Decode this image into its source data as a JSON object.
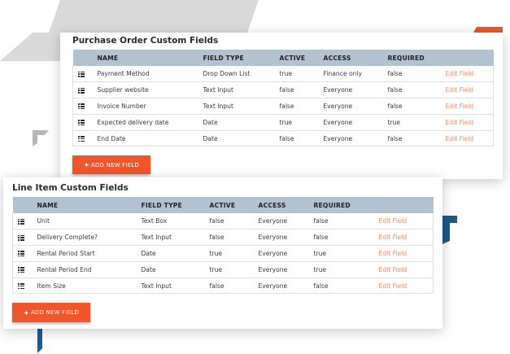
{
  "colors": {
    "accent": "#f0562a",
    "edit_link": "#f08a5e",
    "header_bg": "#b2c2d1",
    "deco_blue": "#1e5a8a",
    "deco_gray": "#d9d9d9"
  },
  "purchase_order": {
    "title": "Purchase Order Custom Fields",
    "columns": [
      "NAME",
      "FIELD TYPE",
      "ACTIVE",
      "ACCESS",
      "REQUIRED",
      ""
    ],
    "rows": [
      {
        "name": "Payment Method",
        "field_type": "Drop Down List",
        "active": "true",
        "access": "Finance only",
        "required": "false",
        "action": "Edit Field"
      },
      {
        "name": "Supplier website",
        "field_type": "Text Input",
        "active": "false",
        "access": "Everyone",
        "required": "false",
        "action": "Edit Field"
      },
      {
        "name": "Invoice Number",
        "field_type": "Text Input",
        "active": "false",
        "access": "Everyone",
        "required": "false",
        "action": "Edit Field"
      },
      {
        "name": "Expected delivery date",
        "field_type": "Date",
        "active": "true",
        "access": "Everyone",
        "required": "true",
        "action": "Edit Field"
      },
      {
        "name": "End Date",
        "field_type": "Date",
        "active": "false",
        "access": "Everyone",
        "required": "false",
        "action": "Edit Field"
      }
    ],
    "add_button": "ADD NEW FIELD"
  },
  "line_item": {
    "title": "Line Item Custom Fields",
    "columns": [
      "NAME",
      "FIELD TYPE",
      "ACTIVE",
      "ACCESS",
      "REQUIRED",
      ""
    ],
    "rows": [
      {
        "name": "Unit",
        "field_type": "Text Box",
        "active": "false",
        "access": "Everyone",
        "required": "false",
        "action": "Edit Field"
      },
      {
        "name": "Delivery Complete?",
        "field_type": "Text Input",
        "active": "false",
        "access": "Everyone",
        "required": "false",
        "action": "Edit Field"
      },
      {
        "name": "Rental Period Start",
        "field_type": "Date",
        "active": "true",
        "access": "Everyone",
        "required": "true",
        "action": "Edit Field"
      },
      {
        "name": "Rental Period End",
        "field_type": "Date",
        "active": "true",
        "access": "Everyone",
        "required": "true",
        "action": "Edit Field"
      },
      {
        "name": "Item Size",
        "field_type": "Text Input",
        "active": "false",
        "access": "Everyone",
        "required": "false",
        "action": "Edit Field"
      }
    ],
    "add_button": "ADD NEW FIELD"
  }
}
